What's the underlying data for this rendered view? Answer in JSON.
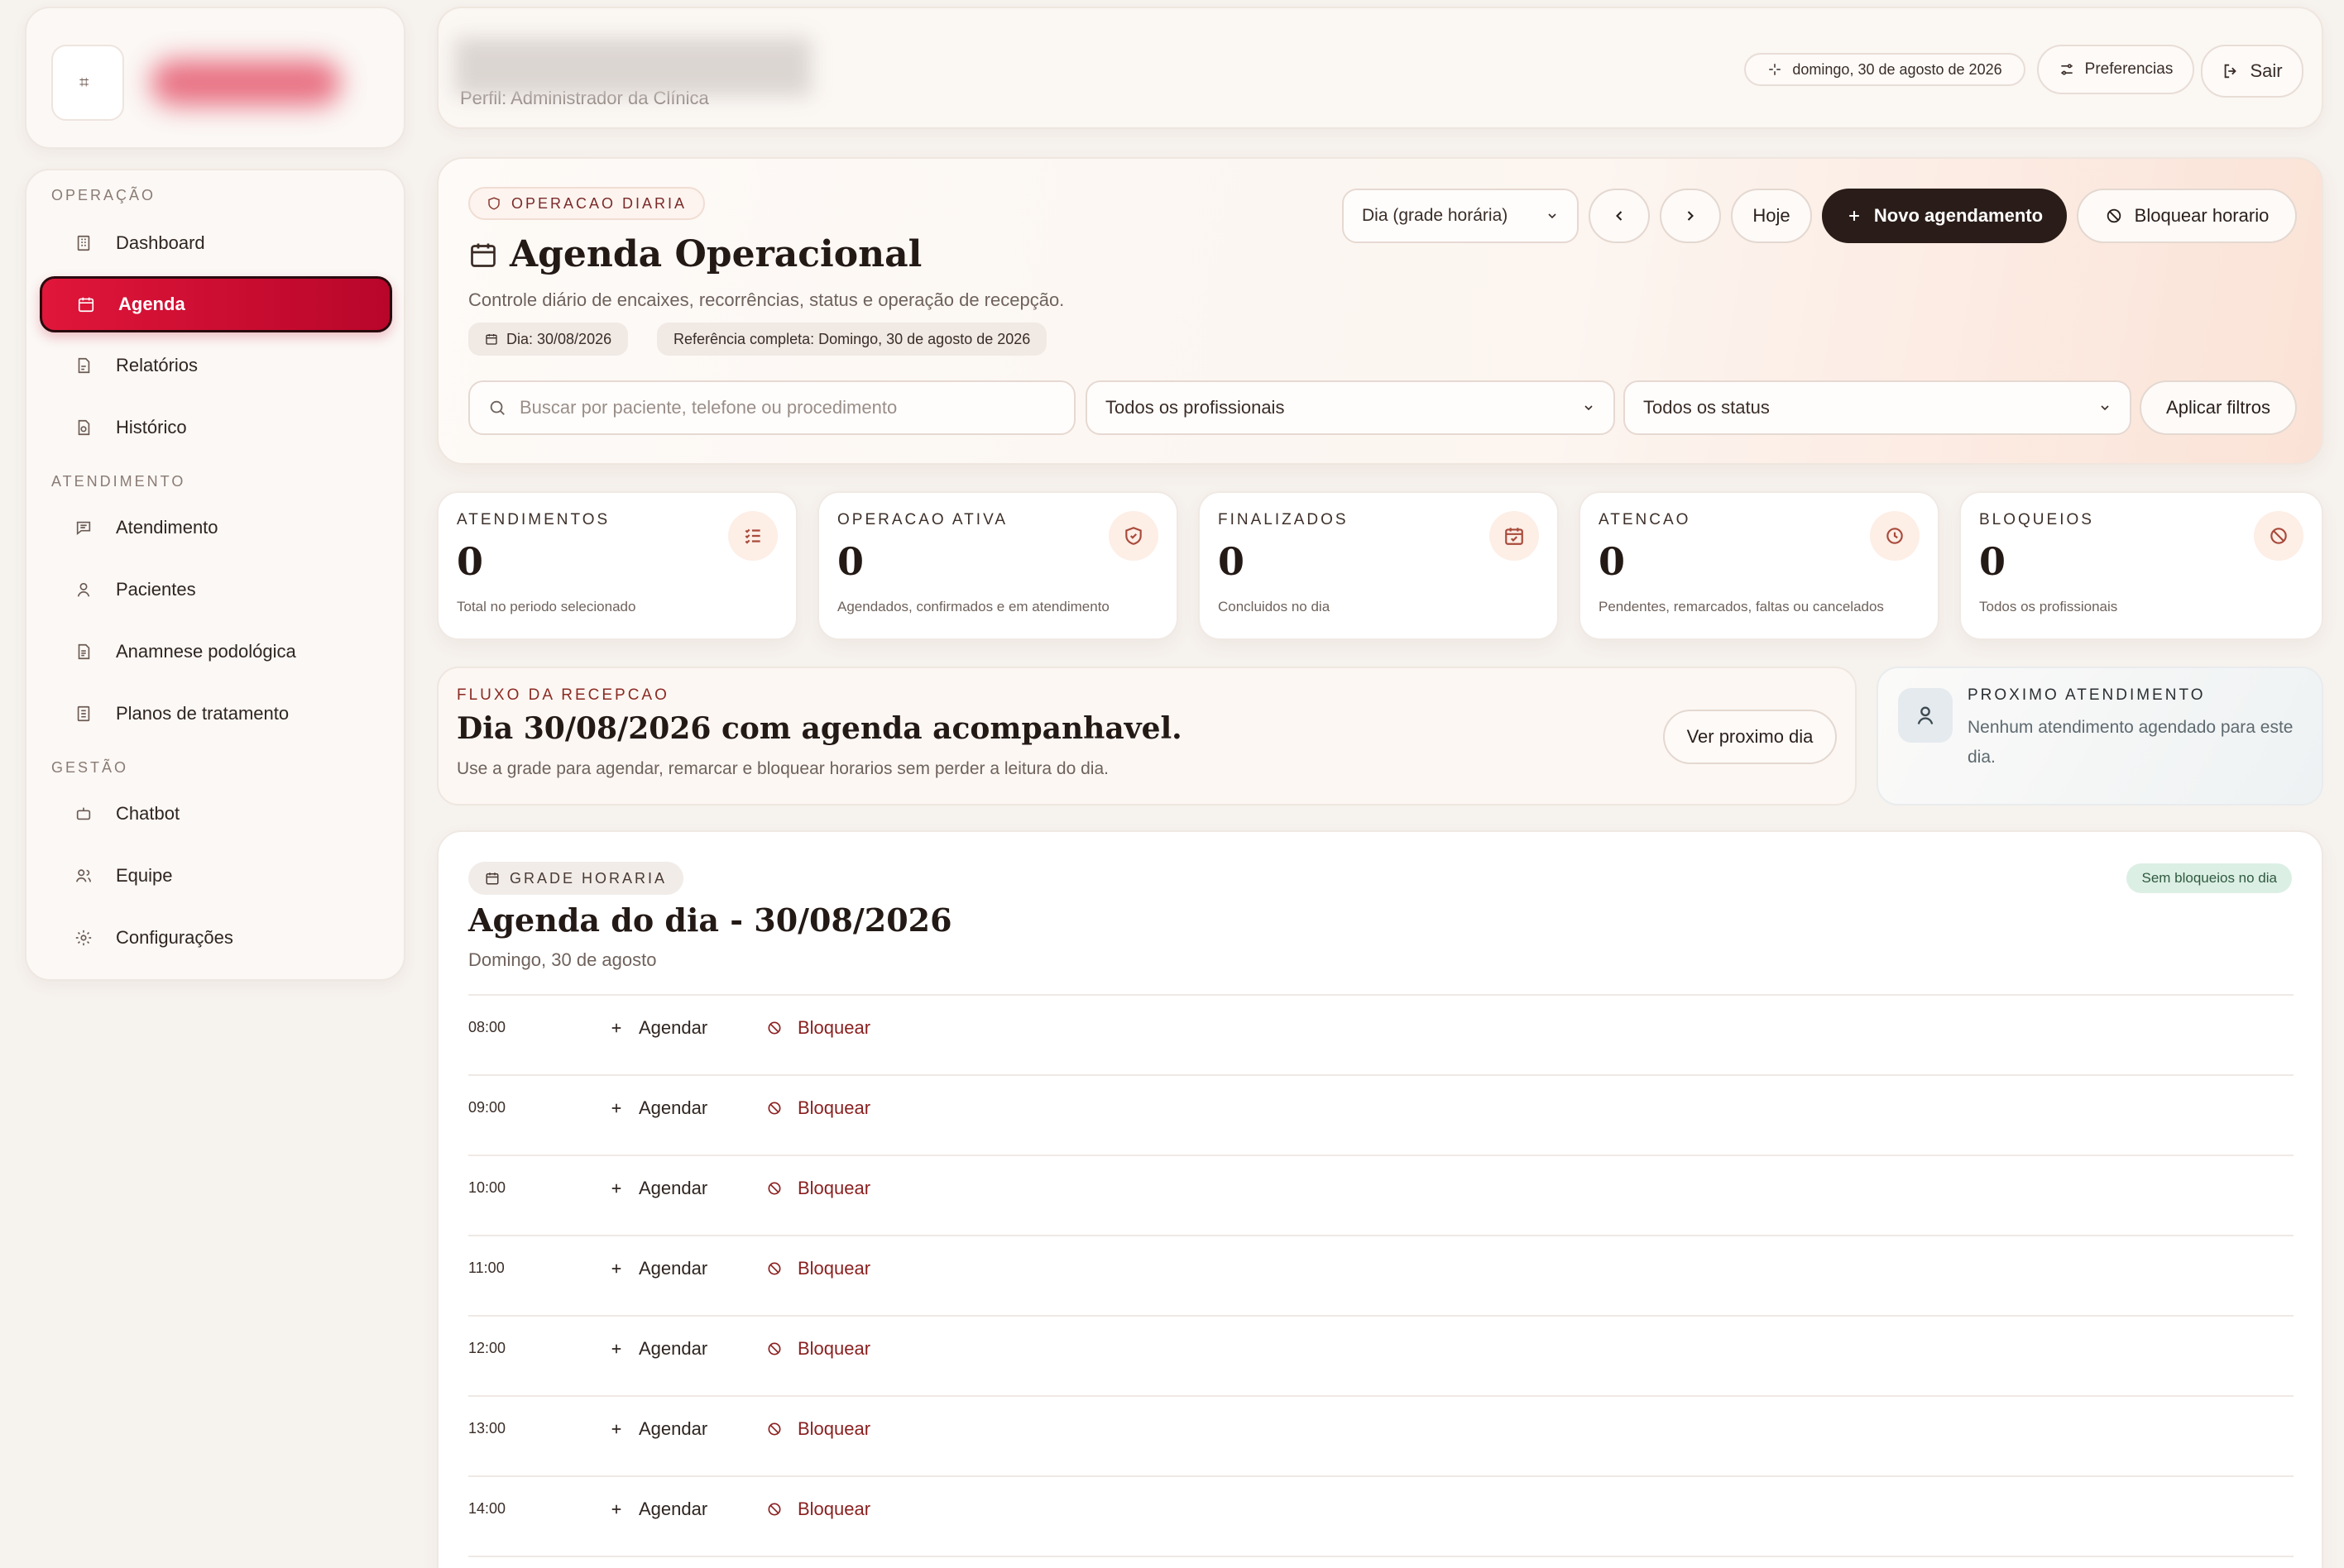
{
  "sidebar": {
    "logo_glyph": "⌗",
    "sections": [
      {
        "title": "OPERAÇÃO",
        "items": [
          {
            "label": "Dashboard",
            "icon": "building-icon"
          },
          {
            "label": "Agenda",
            "icon": "calendar-icon",
            "active": true
          },
          {
            "label": "Relatórios",
            "icon": "report-icon"
          },
          {
            "label": "Histórico",
            "icon": "history-icon"
          }
        ]
      },
      {
        "title": "ATENDIMENTO",
        "items": [
          {
            "label": "Atendimento",
            "icon": "chat-icon"
          },
          {
            "label": "Pacientes",
            "icon": "user-icon"
          },
          {
            "label": "Anamnese podológica",
            "icon": "document-icon"
          },
          {
            "label": "Planos de tratamento",
            "icon": "clipboard-icon"
          }
        ]
      },
      {
        "title": "GESTÃO",
        "items": [
          {
            "label": "Chatbot",
            "icon": "bot-icon"
          },
          {
            "label": "Equipe",
            "icon": "team-icon"
          },
          {
            "label": "Configurações",
            "icon": "gear-icon"
          }
        ]
      }
    ]
  },
  "header": {
    "subtitle": "Perfil: Administrador da Clínica",
    "date": "domingo, 30 de agosto de 2026",
    "preferences": "Preferencias",
    "logout": "Sair"
  },
  "hero": {
    "chip": "OPERACAO DIARIA",
    "title": "Agenda Operacional",
    "description": "Controle diário de encaixes, recorrências, status e operação de recepção.",
    "tag_day": "Dia: 30/08/2026",
    "tag_reference": "Referência completa: Domingo, 30 de agosto de 2026",
    "view_select": "Dia (grade horária)",
    "today": "Hoje",
    "new_appointment": "Novo agendamento",
    "block_time": "Bloquear horario",
    "search_placeholder": "Buscar por paciente, telefone ou procedimento",
    "professionals_select": "Todos os profissionais",
    "status_select": "Todos os status",
    "apply_filters": "Aplicar filtros"
  },
  "stats": [
    {
      "label": "ATENDIMENTOS",
      "value": "0",
      "desc": "Total no periodo selecionado",
      "icon": "checklist-icon"
    },
    {
      "label": "OPERACAO ATIVA",
      "value": "0",
      "desc": "Agendados, confirmados e em atendimento",
      "icon": "shield-check-icon"
    },
    {
      "label": "FINALIZADOS",
      "value": "0",
      "desc": "Concluidos no dia",
      "icon": "calendar-check-icon"
    },
    {
      "label": "ATENCAO",
      "value": "0",
      "desc": "Pendentes, remarcados, faltas ou cancelados",
      "icon": "clock-icon"
    },
    {
      "label": "BLOQUEIOS",
      "value": "0",
      "desc": "Todos os profissionais",
      "icon": "ban-icon"
    }
  ],
  "flow": {
    "kicker": "FLUXO DA RECEPCAO",
    "title": "Dia 30/08/2026 com agenda acompanhavel.",
    "description": "Use a grade para agendar, remarcar e bloquear horarios sem perder a leitura do dia.",
    "next_day": "Ver proximo dia"
  },
  "next": {
    "kicker": "PROXIMO ATENDIMENTO",
    "text": "Nenhum atendimento agendado para este dia."
  },
  "schedule": {
    "chip": "GRADE HORARIA",
    "badge": "Sem bloqueios no dia",
    "title": "Agenda do dia - 30/08/2026",
    "subtitle": "Domingo, 30 de agosto",
    "add_label": "Agendar",
    "block_label": "Bloquear",
    "slots": [
      "08:00",
      "09:00",
      "10:00",
      "11:00",
      "12:00",
      "13:00",
      "14:00"
    ]
  }
}
